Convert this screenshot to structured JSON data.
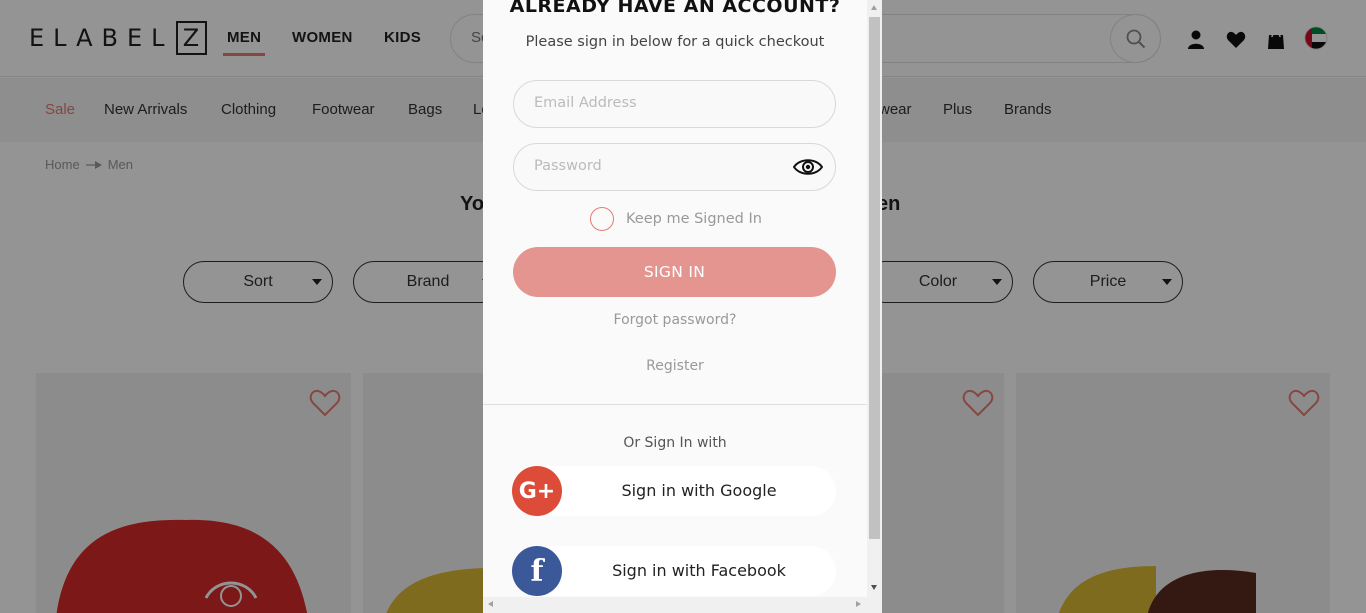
{
  "header": {
    "logo_text": "ELABEL",
    "logo_box_letter": "Z",
    "gender_nav": [
      "MEN",
      "WOMEN",
      "KIDS"
    ],
    "search_placeholder": "Se",
    "accent_color": "#e57a73"
  },
  "categories": [
    "Sale",
    "New Arrivals",
    "Clothing",
    "Footwear",
    "Bags",
    "Le",
    "wear",
    "Plus",
    "Brands"
  ],
  "breadcrumb": [
    "Home",
    "Men"
  ],
  "page_heading": {
    "left": "Yo",
    "right": "en"
  },
  "filters": [
    "Sort",
    "Brand",
    "Color",
    "Price"
  ],
  "modal": {
    "title": "ALREADY HAVE AN ACCOUNT?",
    "subtitle": "Please sign in below for a quick checkout",
    "email_placeholder": "Email Address",
    "password_placeholder": "Password",
    "keep_signed_in": "Keep me Signed In",
    "signin_label": "SIGN IN",
    "forgot_password": "Forgot password?",
    "register": "Register",
    "or_sign_in_with": "Or Sign In with",
    "google_label": "Sign in with Google",
    "google_glyph": "G+",
    "facebook_label": "Sign in with Facebook",
    "facebook_glyph": "f",
    "signin_button_color": "#e4958f",
    "google_color": "#dd4b39",
    "facebook_color": "#3b5998"
  }
}
